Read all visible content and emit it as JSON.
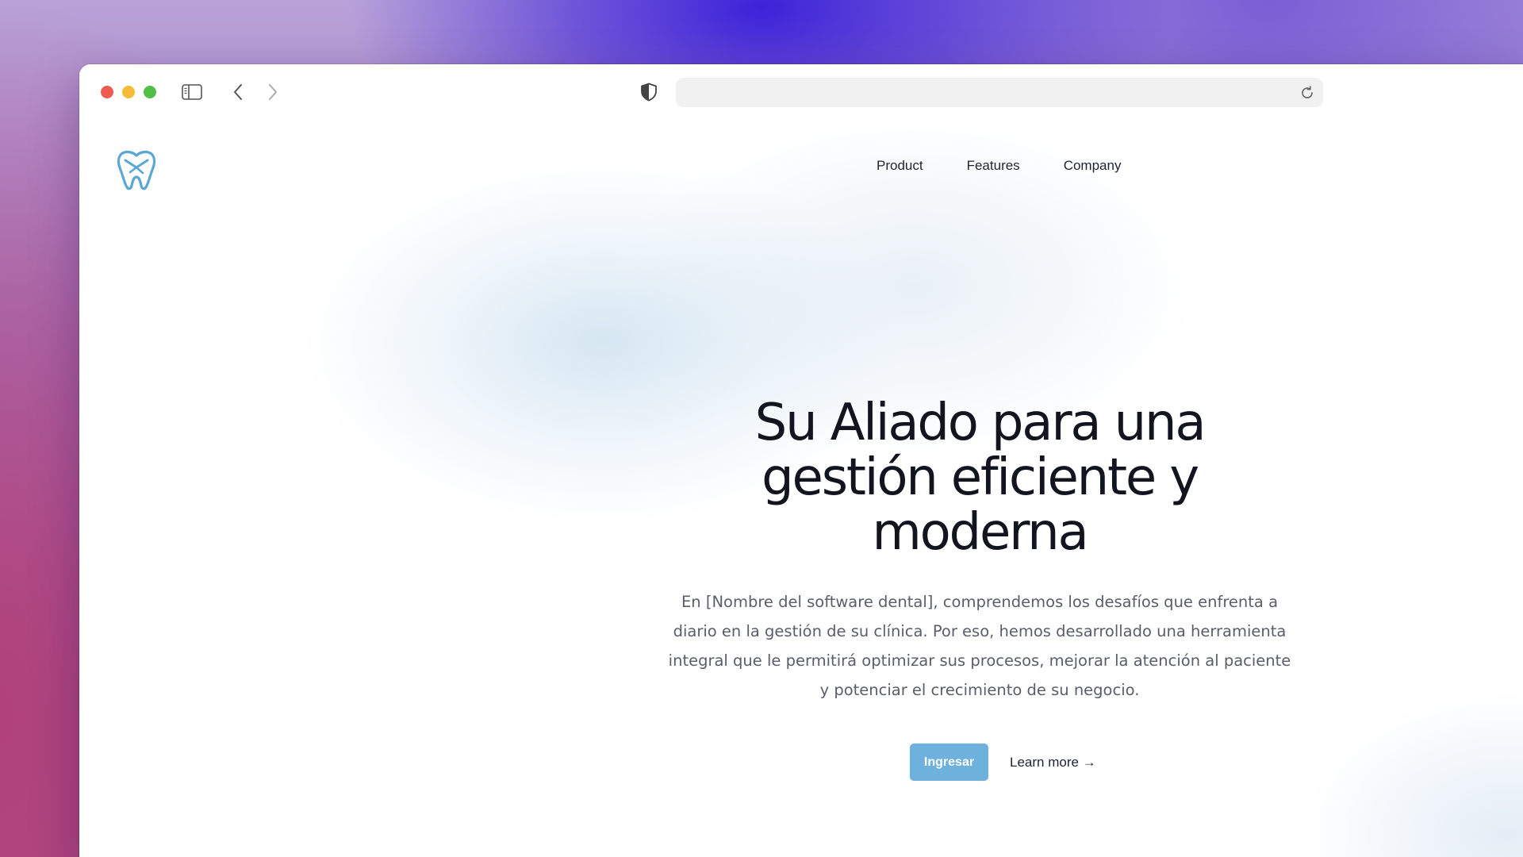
{
  "browser": {
    "address": "",
    "colors": {
      "close": "#ee5b52",
      "minimize": "#f5bb3b",
      "zoom": "#4fc044"
    },
    "icons": [
      "sidebar-icon",
      "chevron-left-icon",
      "chevron-right-icon",
      "shield-icon",
      "reload-icon"
    ]
  },
  "site": {
    "logo_icon": "tooth-icon",
    "nav": {
      "product": "Product",
      "features": "Features",
      "company": "Company"
    },
    "hero": {
      "title": "Su Aliado para una gestión eficiente y moderna",
      "description": "En [Nombre del software dental], comprendemos los desafíos que enfrenta a diario en la gestión de su clínica. Por eso, hemos desarrollado una herramienta integral que le permitirá optimizar sus procesos, mejorar la atención al paciente y potenciar el crecimiento de su negocio.",
      "primary_button": "Ingresar",
      "secondary_link": "Learn more →"
    },
    "colors": {
      "accent": "#6eb1dc",
      "logo": "#5aa7d6",
      "text": "#12151f"
    }
  }
}
